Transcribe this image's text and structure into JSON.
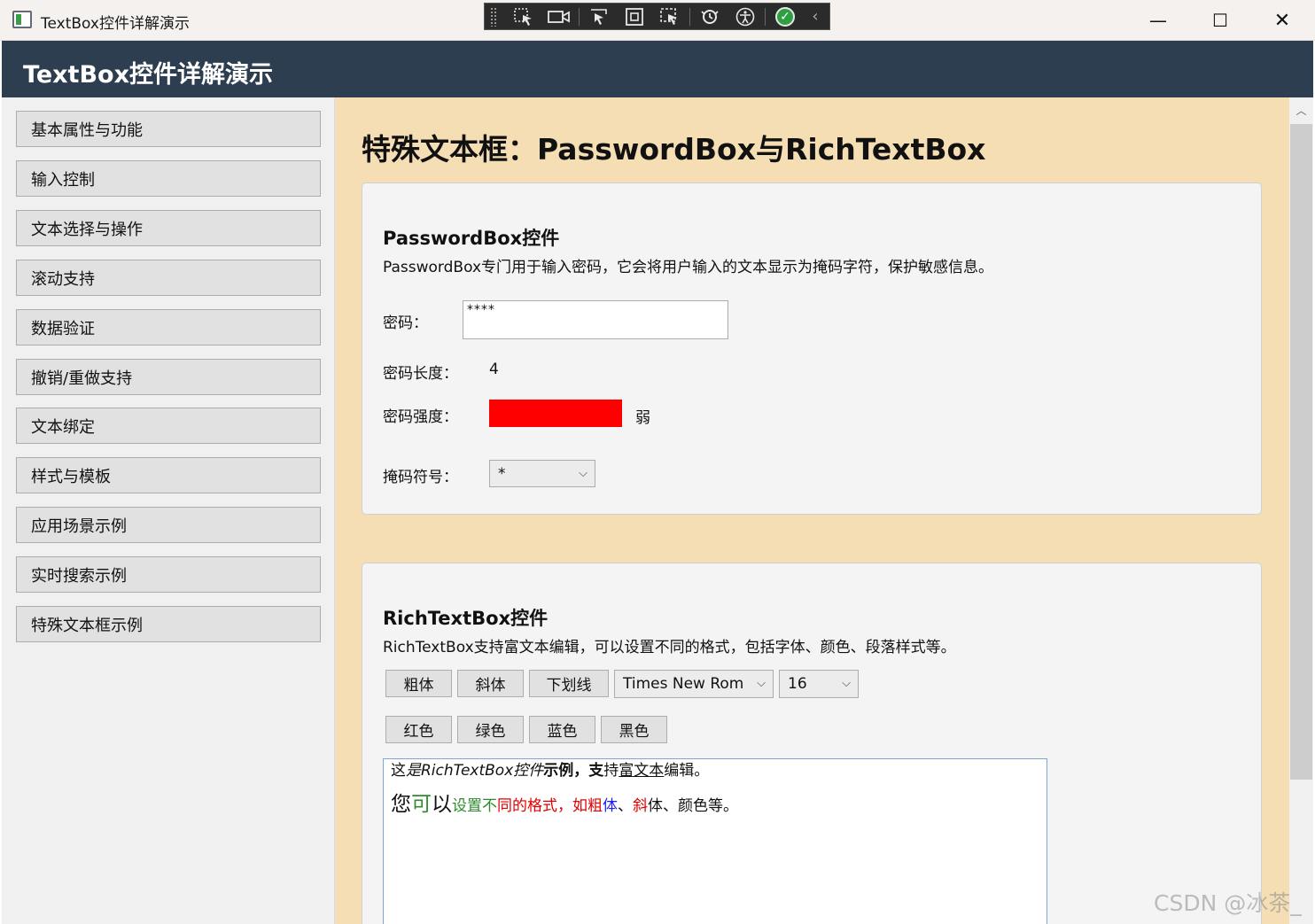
{
  "window": {
    "title": "TextBox控件详解演示",
    "minimize": "—",
    "maximize": "☐",
    "close": "✕"
  },
  "debug_toolbar": {
    "icons": [
      "select-element-icon",
      "video-camera-icon",
      "pointer-select-icon",
      "display-layout-icon",
      "track-focus-icon",
      "hot-reload-icon",
      "accessibility-icon",
      "check-icon",
      "collapse-chevron-icon"
    ]
  },
  "header": {
    "title": "TextBox控件详解演示"
  },
  "sidebar": {
    "items": [
      {
        "label": "基本属性与功能"
      },
      {
        "label": "输入控制"
      },
      {
        "label": "文本选择与操作"
      },
      {
        "label": "滚动支持"
      },
      {
        "label": "数据验证"
      },
      {
        "label": "撤销/重做支持"
      },
      {
        "label": "文本绑定"
      },
      {
        "label": "样式与模板"
      },
      {
        "label": "应用场景示例"
      },
      {
        "label": "实时搜索示例"
      },
      {
        "label": "特殊文本框示例"
      }
    ]
  },
  "main": {
    "title": "特殊文本框：PasswordBox与RichTextBox",
    "password_card": {
      "title": "PasswordBox控件",
      "description": "PasswordBox专门用于输入密码，它会将用户输入的文本显示为掩码字符，保护敏感信息。",
      "password_label": "密码：",
      "password_value": "****",
      "length_label": "密码长度：",
      "length_value": "4",
      "strength_label": "密码强度：",
      "strength_color": "#FF0000",
      "strength_text": "弱",
      "mask_label": "掩码符号：",
      "mask_value": "*"
    },
    "richtext_card": {
      "title": "RichTextBox控件",
      "description": "RichTextBox支持富文本编辑，可以设置不同的格式，包括字体、颜色、段落样式等。",
      "buttons_format": [
        "粗体",
        "斜体",
        "下划线"
      ],
      "font_family_value": "Times New Rom",
      "font_size_value": "16",
      "buttons_color": [
        "红色",
        "绿色",
        "蓝色",
        "黑色"
      ],
      "paragraph1": [
        {
          "text": "这",
          "style": "normal"
        },
        {
          "text": "是RichTextBox控件",
          "style": "italic"
        },
        {
          "text": "示例，支",
          "style": "bold"
        },
        {
          "text": "持",
          "style": "normal"
        },
        {
          "text": "富文本",
          "style": "underline"
        },
        {
          "text": "编辑。",
          "style": "normal"
        }
      ],
      "paragraph2": [
        {
          "text": "您",
          "color": "#111111",
          "size": 23
        },
        {
          "text": "可",
          "color": "#2e8b2e",
          "size": 23
        },
        {
          "text": "以",
          "color": "#111111",
          "size": 23
        },
        {
          "text": "设置不",
          "color": "#2e8b2e",
          "size": 17
        },
        {
          "text": "同的格式，如粗",
          "color": "#e00000",
          "size": 17
        },
        {
          "text": "体",
          "color": "#1a1aff",
          "size": 17
        },
        {
          "text": "、",
          "color": "#111111",
          "size": 17
        },
        {
          "text": "斜",
          "color": "#e00000",
          "size": 17
        },
        {
          "text": "体、颜色等。",
          "color": "#111111",
          "size": 17
        }
      ]
    }
  },
  "watermark": "CSDN @冰茶_"
}
